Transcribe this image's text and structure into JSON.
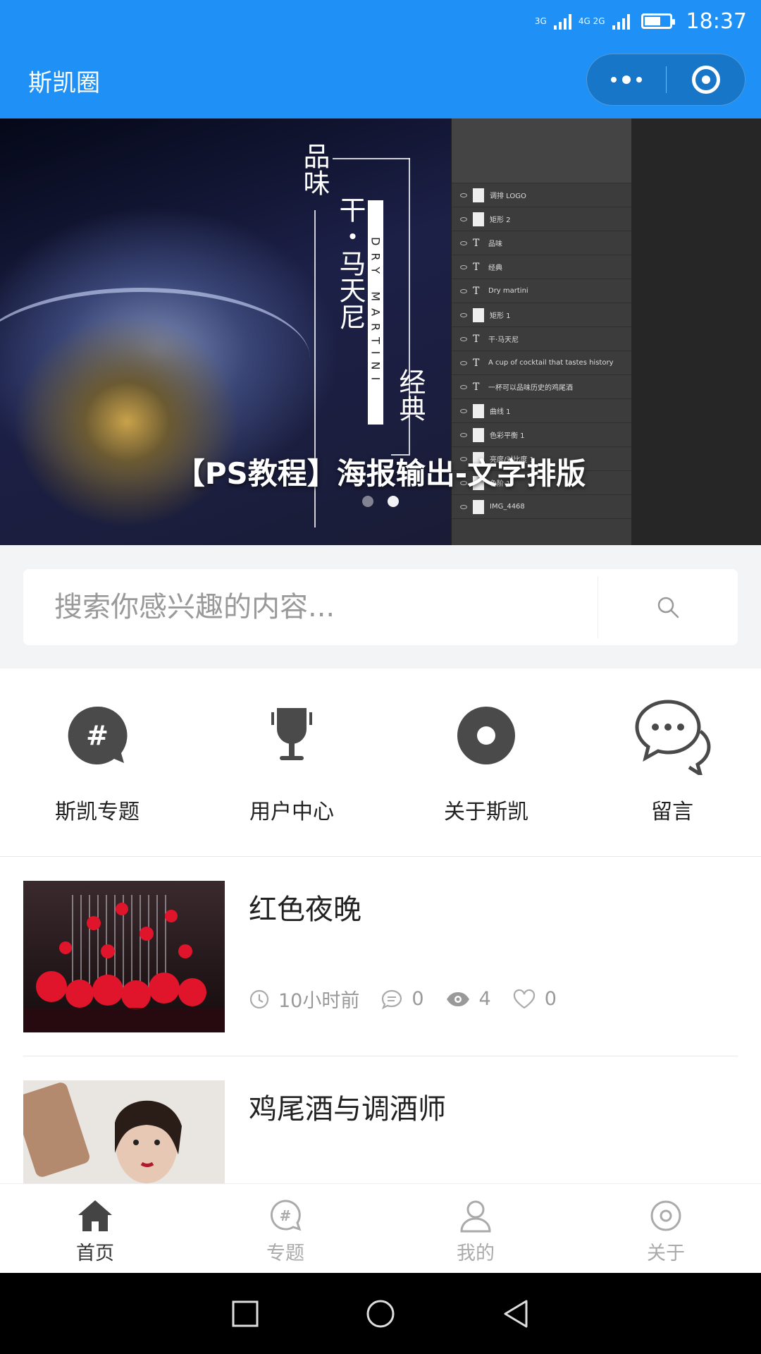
{
  "status_bar": {
    "network_1": "3G",
    "network_2": "4G 2G",
    "time": "18:37",
    "battery_level": 0.6
  },
  "nav": {
    "title": "斯凯圈"
  },
  "banner": {
    "title": "【PS教程】海报输出-文字排版",
    "poster_text_1": "品味",
    "poster_text_2": "干・马天尼",
    "poster_text_3": "DRY MARTINI",
    "poster_text_4": "经典",
    "layers": [
      "调排 LOGO",
      "矩形 2",
      "品味",
      "经典",
      "Dry martini",
      "矩形 1",
      "干·马天尼",
      "A cup of cocktail that tastes history",
      "一杯可以品味历史的鸡尾酒",
      "曲线 1",
      "色彩平衡 1",
      "亮度/对比度 1",
      "色阶 1",
      "IMG_4468"
    ],
    "slide_count": 2,
    "active_slide": 2
  },
  "search": {
    "placeholder": "搜索你感兴趣的内容..."
  },
  "quick_nav": [
    {
      "label": "斯凯专题",
      "icon": "topic-icon"
    },
    {
      "label": "用户中心",
      "icon": "trophy-icon"
    },
    {
      "label": "关于斯凯",
      "icon": "disc-icon"
    },
    {
      "label": "留言",
      "icon": "chat-bubbles-icon"
    }
  ],
  "articles": [
    {
      "title": "红色夜晚",
      "time": "10小时前",
      "comments": "0",
      "views": "4",
      "likes": "0"
    },
    {
      "title": "鸡尾酒与调酒师"
    }
  ],
  "tabbar": [
    {
      "label": "首页",
      "active": true
    },
    {
      "label": "专题",
      "active": false
    },
    {
      "label": "我的",
      "active": false
    },
    {
      "label": "关于",
      "active": false
    }
  ],
  "colors": {
    "brand_blue": "#1e90f6",
    "icon_dark": "#4a4a4a",
    "tab_inactive": "#aaaaaa"
  }
}
